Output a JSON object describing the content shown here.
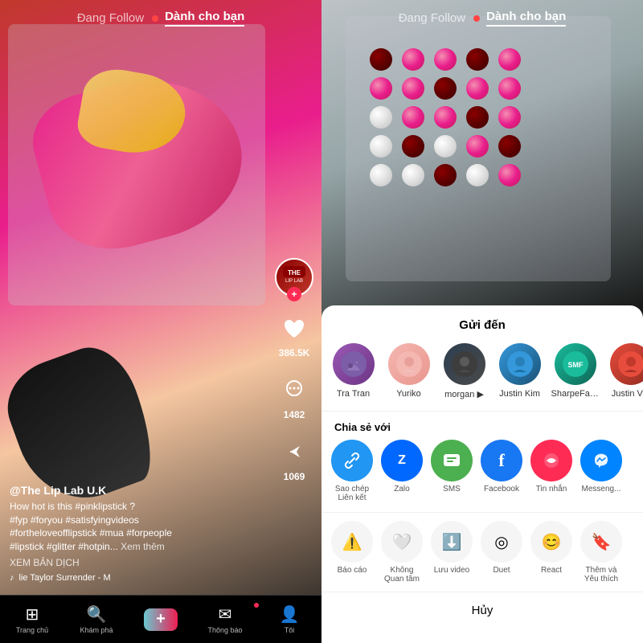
{
  "header": {
    "tab_following": "Đang Follow",
    "tab_foryou": "Dành cho bạn",
    "live_dot_color": "#ff4444"
  },
  "left_video": {
    "username": "@The Lip Lab U.K",
    "description": "How hot is this #pinklipstick ?\n#fyp #foryou #satisfyingvideos\n#fortheloveofflipstick #mua #forpeople\n#lipstick #glitter #hotpin...  ",
    "see_more": "Xem thêm",
    "translate": "XEM BẢN DỊCH",
    "music": "♪  lie Taylor   Surrender - M",
    "likes": "386.5K",
    "comments": "1482",
    "shares": "1069"
  },
  "share_sheet": {
    "title": "Gửi đến",
    "share_with_title": "Chia sẻ với",
    "friends": [
      {
        "name": "Tra Tran",
        "color": "av-purple"
      },
      {
        "name": "Yuriko",
        "color": "av-pink"
      },
      {
        "name": "morgan ▶",
        "color": "av-dark"
      },
      {
        "name": "Justin Kim",
        "color": "av-blue"
      },
      {
        "name": "SharpeFamilySingers",
        "color": "av-teal"
      },
      {
        "name": "Justin Vib",
        "color": "av-red"
      }
    ],
    "share_options": [
      {
        "label": "Sao chép\nLiên kết",
        "icon": "🔗",
        "bg": "link-icon-bg"
      },
      {
        "label": "Zalo",
        "icon": "Z",
        "bg": "zalo-icon-bg"
      },
      {
        "label": "SMS",
        "icon": "💬",
        "bg": "sms-icon-bg"
      },
      {
        "label": "Facebook",
        "icon": "f",
        "bg": "fb-icon-bg"
      },
      {
        "label": "Tin nhắn",
        "icon": "💬",
        "bg": "tin-nhan-bg"
      },
      {
        "label": "Messeng...",
        "icon": "m",
        "bg": "messenger-bg"
      }
    ],
    "actions": [
      {
        "label": "Báo cáo",
        "icon": "⚠️"
      },
      {
        "label": "Không\nQuan tâm",
        "icon": "🤍"
      },
      {
        "label": "Lưu video",
        "icon": "⬇️"
      },
      {
        "label": "Duet",
        "icon": "◎"
      },
      {
        "label": "React",
        "icon": "😊"
      },
      {
        "label": "Thêm và\nYêu thích",
        "icon": "🔖"
      }
    ],
    "cancel": "Hủy"
  },
  "bottom_nav": [
    {
      "icon": "⊞",
      "label": "Trang chủ"
    },
    {
      "icon": "🔍",
      "label": "Khám phá"
    },
    {
      "icon": "+",
      "label": ""
    },
    {
      "icon": "✉",
      "label": "Thông báo"
    },
    {
      "icon": "👤",
      "label": "Tôi"
    }
  ]
}
